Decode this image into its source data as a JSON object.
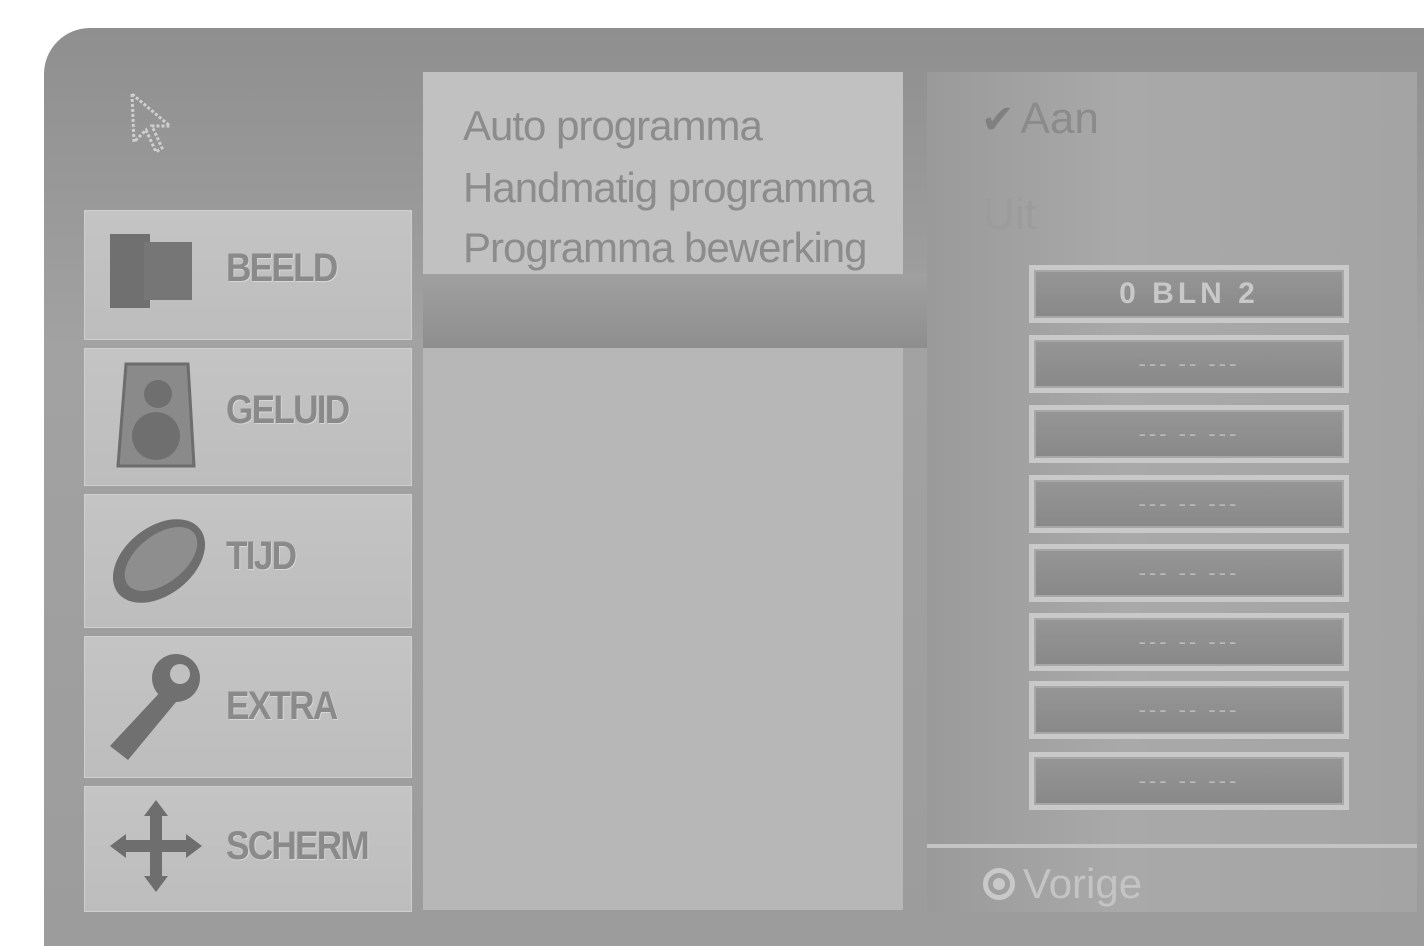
{
  "menu": {
    "sidebar": [
      {
        "label": "BEELD",
        "icon": "picture-icon"
      },
      {
        "label": "GELUID",
        "icon": "speaker-icon"
      },
      {
        "label": "TIJD",
        "icon": "clock-icon"
      },
      {
        "label": "EXTRA",
        "icon": "wrench-icon"
      },
      {
        "label": "SCHERM",
        "icon": "move-arrows-icon"
      }
    ],
    "submenu": [
      "Auto programma",
      "Handmatig programma",
      "Programma bewerking"
    ],
    "options": {
      "on": "Aan",
      "off": "Uit"
    },
    "channels": [
      "0 BLN 2",
      "--- -- ---",
      "--- -- ---",
      "--- -- ---",
      "--- -- ---",
      "--- -- ---",
      "--- -- ---",
      "--- -- ---"
    ],
    "back_label": "Vorige"
  }
}
